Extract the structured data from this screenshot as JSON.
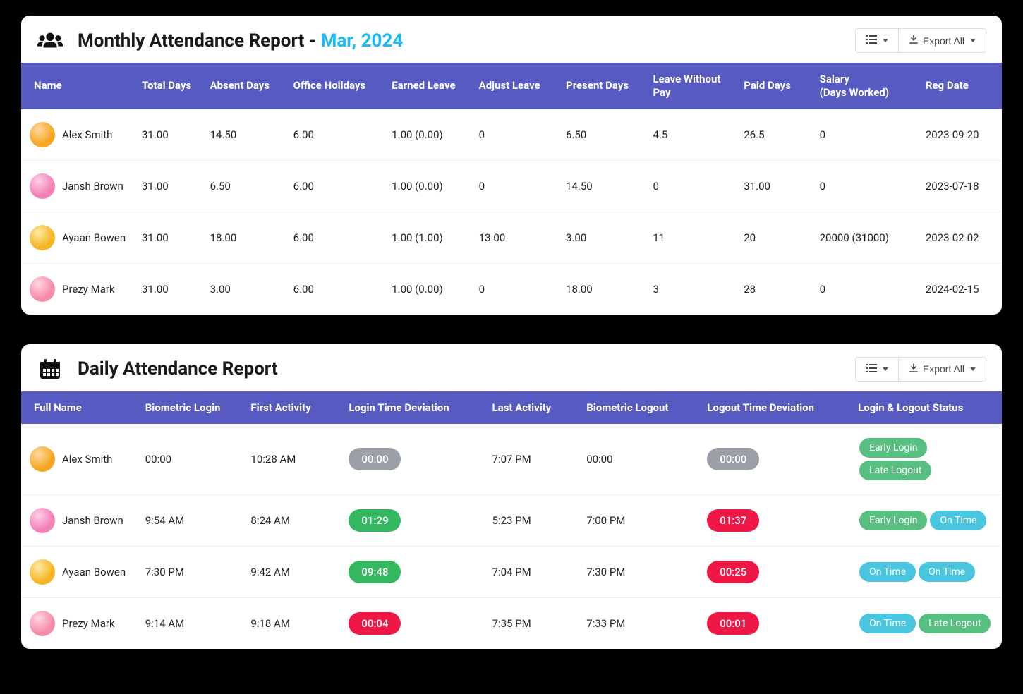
{
  "monthly": {
    "title_prefix": "Monthly Attendance Report - ",
    "title_accent": "Mar, 2024",
    "export_label": "Export All",
    "headers": {
      "name": "Name",
      "total_days": "Total Days",
      "absent_days": "Absent Days",
      "office_holidays": "Office Holidays",
      "earned_leave": "Earned Leave",
      "adjust_leave": "Adjust Leave",
      "present_days": "Present Days",
      "lwop": "Leave Without Pay",
      "paid_days": "Paid Days",
      "salary": "Salary\n(Days Worked)",
      "reg_date": "Reg Date"
    },
    "rows": [
      {
        "name": "Alex Smith",
        "avatar_class": "av-orange",
        "total": "31.00",
        "absent": "14.50",
        "holidays": "6.00",
        "earned": "1.00 (0.00)",
        "adjust": "0",
        "present": "6.50",
        "lwop": "4.5",
        "paid": "26.5",
        "salary": "0",
        "reg": "2023-09-20"
      },
      {
        "name": "Jansh Brown",
        "avatar_class": "av-pink",
        "total": "31.00",
        "absent": "6.50",
        "holidays": "6.00",
        "earned": "1.00 (0.00)",
        "adjust": "0",
        "present": "14.50",
        "lwop": "0",
        "paid": "31.00",
        "salary": "0",
        "reg": "2023-07-18"
      },
      {
        "name": "Ayaan Bowen",
        "avatar_class": "av-yellow",
        "total": "31.00",
        "absent": "18.00",
        "holidays": "6.00",
        "earned": "1.00 (1.00)",
        "adjust": "13.00",
        "present": "3.00",
        "lwop": "11",
        "paid": "20",
        "salary": "20000 (31000)",
        "reg": "2023-02-02"
      },
      {
        "name": "Prezy Mark",
        "avatar_class": "av-rose",
        "total": "31.00",
        "absent": "3.00",
        "holidays": "6.00",
        "earned": "1.00 (0.00)",
        "adjust": "0",
        "present": "18.00",
        "lwop": "3",
        "paid": "28",
        "salary": "0",
        "reg": "2024-02-15"
      }
    ]
  },
  "daily": {
    "title": "Daily Attendance Report",
    "export_label": "Export All",
    "headers": {
      "full_name": "Full Name",
      "bio_login": "Biometric Login",
      "first_activity": "First Activity",
      "login_dev": "Login Time Deviation",
      "last_activity": "Last Activity",
      "bio_logout": "Biometric Logout",
      "logout_dev": "Logout Time Deviation",
      "status": "Login & Logout Status"
    },
    "rows": [
      {
        "name": "Alex Smith",
        "avatar_class": "av-orange",
        "bio_login": "00:00",
        "first": "10:28 AM",
        "login_dev": "00:00",
        "login_dev_style": "grey",
        "last": "7:07 PM",
        "bio_logout": "00:00",
        "logout_dev": "00:00",
        "logout_dev_style": "grey",
        "badges": [
          {
            "text": "Early Login",
            "style": "green"
          },
          {
            "text": "Late Logout",
            "style": "green"
          }
        ]
      },
      {
        "name": "Jansh Brown",
        "avatar_class": "av-pink",
        "bio_login": "9:54 AM",
        "first": "8:24 AM",
        "login_dev": "01:29",
        "login_dev_style": "green",
        "last": "5:23 PM",
        "bio_logout": "7:00 PM",
        "logout_dev": "01:37",
        "logout_dev_style": "red",
        "badges": [
          {
            "text": "Early Login",
            "style": "green"
          },
          {
            "text": "On Time",
            "style": "cyan"
          }
        ]
      },
      {
        "name": "Ayaan Bowen",
        "avatar_class": "av-yellow",
        "bio_login": "7:30 PM",
        "first": "9:42 AM",
        "login_dev": "09:48",
        "login_dev_style": "green",
        "last": "7:04 PM",
        "bio_logout": "7:30 PM",
        "logout_dev": "00:25",
        "logout_dev_style": "red",
        "badges": [
          {
            "text": "On Time",
            "style": "cyan"
          },
          {
            "text": "On Time",
            "style": "cyan"
          }
        ]
      },
      {
        "name": "Prezy Mark",
        "avatar_class": "av-rose",
        "bio_login": "9:14 AM",
        "first": "9:18 AM",
        "login_dev": "00:04",
        "login_dev_style": "red",
        "last": "7:35 PM",
        "bio_logout": "7:33 PM",
        "logout_dev": "00:01",
        "logout_dev_style": "red",
        "badges": [
          {
            "text": "On Time",
            "style": "cyan"
          },
          {
            "text": "Late Logout",
            "style": "green"
          }
        ]
      }
    ]
  }
}
